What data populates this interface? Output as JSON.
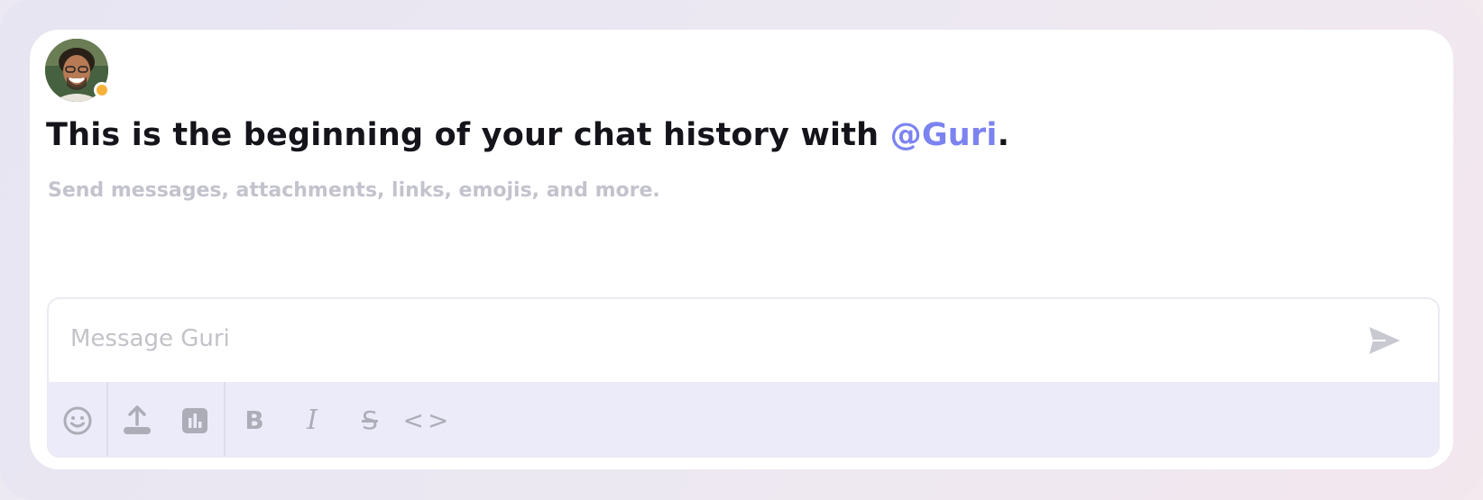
{
  "chat": {
    "headline_prefix": "This is the beginning of your chat history with ",
    "mention": "@Guri",
    "headline_suffix": ".",
    "subline": "Send messages, attachments, links, emojis, and more."
  },
  "user": {
    "presence_color": "#f7b23b",
    "status": "away"
  },
  "composer": {
    "placeholder": "Message Guri"
  },
  "toolbar": {
    "bold_label": "B",
    "italic_label": "I",
    "strike_label": "S",
    "code_label": "<>"
  },
  "colors": {
    "accent": "#7c83f0",
    "toolbar_bg": "#ebebf9",
    "icon": "#adadb8"
  }
}
